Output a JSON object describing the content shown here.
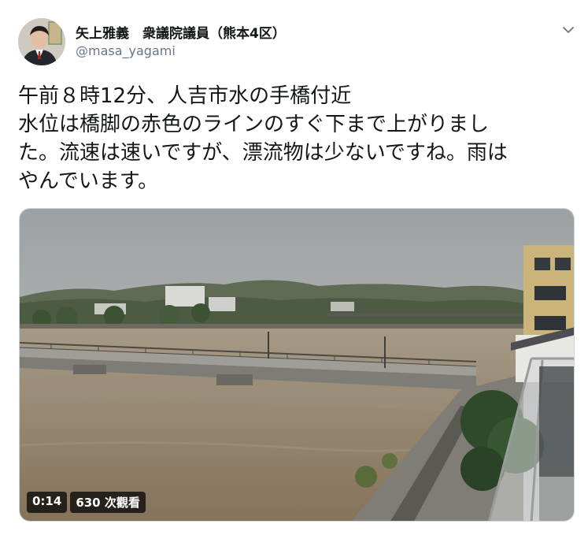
{
  "author": {
    "display_name": "矢上雅義　衆議院議員（熊本4区）",
    "handle": "@masa_yagami"
  },
  "tweet": {
    "lines": [
      "午前８時12分、人吉市水の手橋付近",
      "水位は橋脚の赤色のラインのすぐ下まで上がりまし",
      "た。流速は速いですが、漂流物は少ないですね。雨は",
      "やんでいます。"
    ]
  },
  "video": {
    "duration": "0:14",
    "views": "630 次觀看"
  },
  "colors": {
    "text": "#14171a",
    "secondary": "#657786",
    "river": "#8b7a62"
  }
}
